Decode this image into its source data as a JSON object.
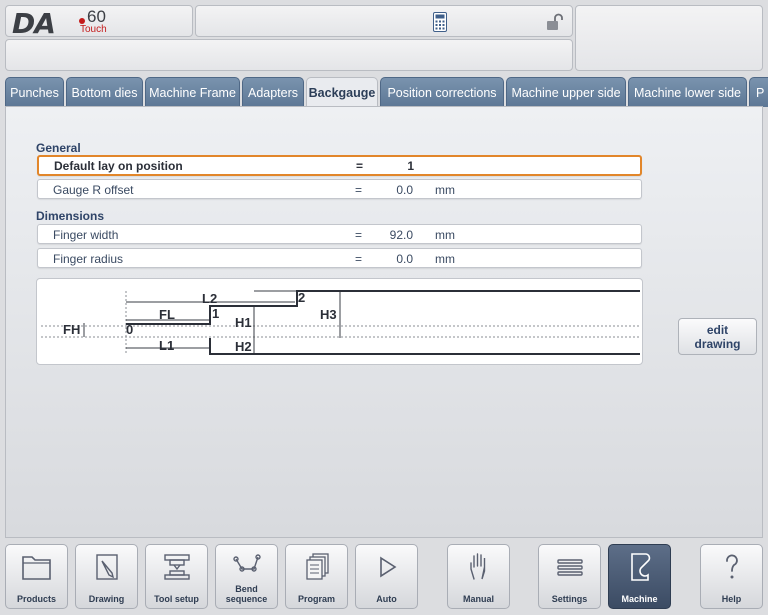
{
  "header": {
    "logo_text": "DA",
    "logo_model": "60",
    "logo_suffix": "Touch"
  },
  "icons": {
    "calculator": "calculator-icon",
    "lock": "unlocked-padlock-icon"
  },
  "tabs": [
    {
      "label": "Punches",
      "active": false
    },
    {
      "label": "Bottom dies",
      "active": false
    },
    {
      "label": "Machine Frame",
      "active": false
    },
    {
      "label": "Adapters",
      "active": false
    },
    {
      "label": "Backgauge",
      "active": true
    },
    {
      "label": "Position corrections",
      "active": false
    },
    {
      "label": "Machine upper side",
      "active": false
    },
    {
      "label": "Machine lower side",
      "active": false
    },
    {
      "label": "P",
      "active": false
    }
  ],
  "sections": {
    "general": {
      "title": "General",
      "rows": [
        {
          "label": "Default lay on position",
          "eq": "=",
          "value": "1",
          "unit": ""
        },
        {
          "label": "Gauge R offset",
          "eq": "=",
          "value": "0.0",
          "unit": "mm"
        }
      ]
    },
    "dimensions": {
      "title": "Dimensions",
      "rows": [
        {
          "label": "Finger width",
          "eq": "=",
          "value": "92.0",
          "unit": "mm"
        },
        {
          "label": "Finger radius",
          "eq": "=",
          "value": "0.0",
          "unit": "mm"
        }
      ]
    }
  },
  "drawing": {
    "labels": {
      "fh": "FH",
      "fl": "FL",
      "l1": "L1",
      "l2": "L2",
      "h1": "H1",
      "h2": "H2",
      "h3": "H3",
      "p0": "0",
      "p1": "1",
      "p2": "2"
    }
  },
  "edit_drawing": {
    "line1": "edit",
    "line2": "drawing"
  },
  "bottom_bar": [
    {
      "label": "Products",
      "icon": "folder-icon"
    },
    {
      "label": "Drawing",
      "icon": "pencil-icon"
    },
    {
      "label": "Tool setup",
      "icon": "tool-setup-icon"
    },
    {
      "label": "Bend\nsequence",
      "icon": "bend-sequence-icon"
    },
    {
      "label": "Program",
      "icon": "program-pages-icon"
    },
    {
      "label": "Auto",
      "icon": "play-icon"
    },
    {
      "label": "Manual",
      "icon": "hand-icon"
    },
    {
      "label": "Settings",
      "icon": "settings-list-icon"
    },
    {
      "label": "Machine",
      "icon": "machine-icon",
      "active": true
    },
    {
      "label": "Help",
      "icon": "help-icon"
    }
  ],
  "colors": {
    "accent_selected": "#e2862a",
    "tab_blue": "#5d7795",
    "section_title": "#2f4468"
  }
}
